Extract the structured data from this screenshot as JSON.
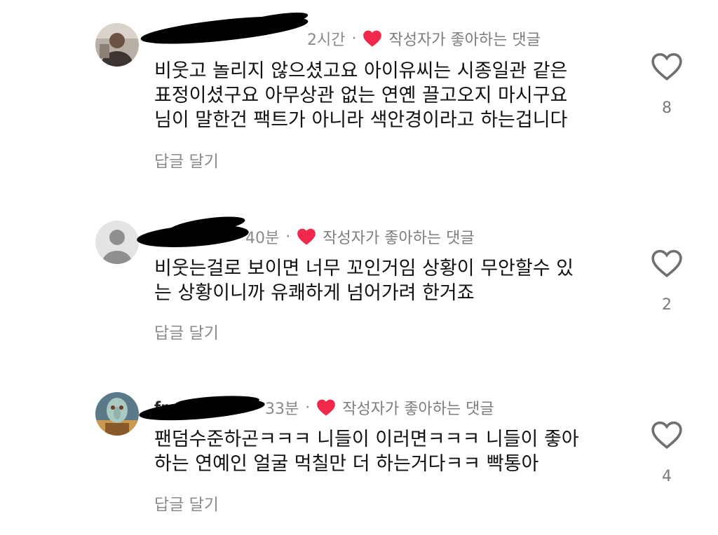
{
  "comments": [
    {
      "user": "l",
      "time": "2시간",
      "dot": "·",
      "liked_label": "작성자가 좋아하는 댓글",
      "lines": [
        "비웃고 놀리지 않으셨고요 아이유씨는 시종일관 같은",
        "표정이셨구요 아무상관 없는 연옌 끌고오지 마시구요",
        "님이 말한건 팩트가 아니라 색안경이라고 하는겁니다"
      ],
      "reply_label": "답글 달기",
      "like_count": "8"
    },
    {
      "user": "",
      "time": "40분",
      "dot": "·",
      "liked_label": "작성자가 좋아하는 댓글",
      "lines": [
        "비웃는걸로 보이면 너무 꼬인거임 상황이 무안할수 있",
        "는 상황이니까 유쾌하게 넘어가려 한거죠"
      ],
      "reply_label": "답글 달기",
      "like_count": "2"
    },
    {
      "user": "fr",
      "time": "33분",
      "dot": "·",
      "liked_label": "작성자가 좋아하는 댓글",
      "lines": [
        "팬덤수준하곤ㅋㅋㅋ 니들이 이러면ㅋㅋㅋ 니들이 좋아",
        "하는 연예인 얼굴 먹칠만 더 하는거다ㅋㅋ 빡통아"
      ],
      "reply_label": "답글 달기",
      "like_count": "4"
    }
  ],
  "icons": {
    "liked_by_author": "heart-icon",
    "like": "heart-outline-icon",
    "avatar_default": "person-icon"
  },
  "colors": {
    "heart_red": "#f02849",
    "muted_text": "#8a8a8a",
    "body_text": "#111111"
  }
}
